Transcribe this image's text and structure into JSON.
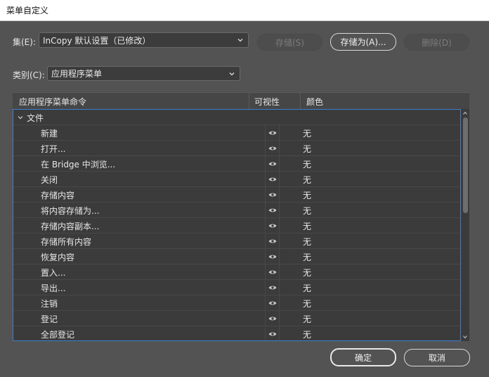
{
  "window": {
    "title": "菜单自定义"
  },
  "set": {
    "label": "集(E):",
    "selected": "InCopy 默认设置（已修改）"
  },
  "buttons": {
    "save": "存储(S)",
    "save_as": "存储为(A)...",
    "delete": "删除(D)",
    "ok": "确定",
    "cancel": "取消"
  },
  "category": {
    "label": "类别(C):",
    "selected": "应用程序菜单"
  },
  "table": {
    "headers": {
      "command": "应用程序菜单命令",
      "visibility": "可视性",
      "color": "颜色"
    },
    "group": "文件",
    "rows": [
      {
        "command": "新建",
        "color": "无"
      },
      {
        "command": "打开...",
        "color": "无"
      },
      {
        "command": "在 Bridge 中浏览...",
        "color": "无"
      },
      {
        "command": "关闭",
        "color": "无"
      },
      {
        "command": "存储内容",
        "color": "无"
      },
      {
        "command": "将内容存储为...",
        "color": "无"
      },
      {
        "command": "存储内容副本...",
        "color": "无"
      },
      {
        "command": "存储所有内容",
        "color": "无"
      },
      {
        "command": "恢复内容",
        "color": "无"
      },
      {
        "command": "置入...",
        "color": "无"
      },
      {
        "command": "导出...",
        "color": "无"
      },
      {
        "command": "注销",
        "color": "无"
      },
      {
        "command": "登记",
        "color": "无"
      },
      {
        "command": "全部登记",
        "color": "无"
      }
    ]
  },
  "icons": {
    "visibility": "eye-icon",
    "expand": "chevron-down-icon"
  },
  "colors": {
    "dialog_bg": "#535353",
    "list_bg": "#3b3b3b",
    "focus_border": "#3d7fd0"
  }
}
